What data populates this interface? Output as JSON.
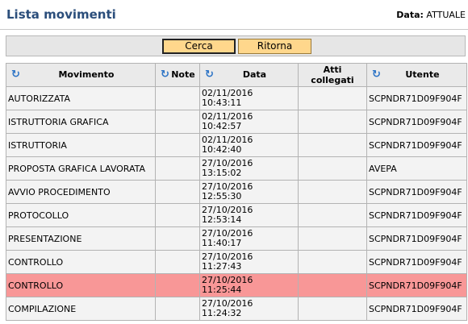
{
  "header": {
    "title": "Lista movimenti",
    "date_label": "Data:",
    "date_value": "ATTUALE"
  },
  "toolbar": {
    "cerca_label": "Cerca",
    "ritorna_label": "Ritorna"
  },
  "table": {
    "columns": [
      {
        "label": "Movimento",
        "sortable": true
      },
      {
        "label": "Note",
        "sortable": true
      },
      {
        "label": "Data",
        "sortable": true
      },
      {
        "label": "Atti collegati",
        "sortable": false
      },
      {
        "label": "Utente",
        "sortable": true
      }
    ],
    "rows": [
      {
        "movimento": "AUTORIZZATA",
        "note": "",
        "data": "02/11/2016",
        "ora": "10:43:11",
        "atti": "",
        "utente": "SCPNDR71D09F904F",
        "selected": false
      },
      {
        "movimento": "ISTRUTTORIA GRAFICA",
        "note": "",
        "data": "02/11/2016",
        "ora": "10:42:57",
        "atti": "",
        "utente": "SCPNDR71D09F904F",
        "selected": false
      },
      {
        "movimento": "ISTRUTTORIA",
        "note": "",
        "data": "02/11/2016",
        "ora": "10:42:40",
        "atti": "",
        "utente": "SCPNDR71D09F904F",
        "selected": false
      },
      {
        "movimento": "PROPOSTA GRAFICA LAVORATA",
        "note": "",
        "data": "27/10/2016",
        "ora": "13:15:02",
        "atti": "",
        "utente": "AVEPA",
        "selected": false
      },
      {
        "movimento": "AVVIO PROCEDIMENTO",
        "note": "",
        "data": "27/10/2016",
        "ora": "12:55:30",
        "atti": "",
        "utente": "SCPNDR71D09F904F",
        "selected": false
      },
      {
        "movimento": "PROTOCOLLO",
        "note": "",
        "data": "27/10/2016",
        "ora": "12:53:14",
        "atti": "",
        "utente": "SCPNDR71D09F904F",
        "selected": false
      },
      {
        "movimento": "PRESENTAZIONE",
        "note": "",
        "data": "27/10/2016",
        "ora": "11:40:17",
        "atti": "",
        "utente": "SCPNDR71D09F904F",
        "selected": false
      },
      {
        "movimento": "CONTROLLO",
        "note": "",
        "data": "27/10/2016",
        "ora": "11:27:43",
        "atti": "",
        "utente": "SCPNDR71D09F904F",
        "selected": false
      },
      {
        "movimento": "CONTROLLO",
        "note": "",
        "data": "27/10/2016",
        "ora": "11:25:44",
        "atti": "",
        "utente": "SCPNDR71D09F904F",
        "selected": true
      },
      {
        "movimento": "COMPILAZIONE",
        "note": "",
        "data": "27/10/2016",
        "ora": "11:24:32",
        "atti": "",
        "utente": "SCPNDR71D09F904F",
        "selected": false
      }
    ]
  },
  "colors": {
    "title": "#2b4e7b",
    "button_bg": "#ffd78c",
    "selected_row": "#f89797",
    "sort_icon": "#2d74c6"
  },
  "icons": {
    "sort": "refresh-sort-icon"
  }
}
